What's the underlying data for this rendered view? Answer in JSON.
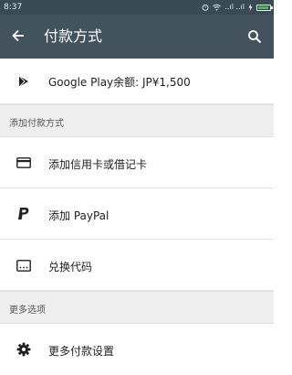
{
  "status_bar": {
    "time": "8:37",
    "signal_text": "..ıl ..ıl"
  },
  "app_bar": {
    "title": "付款方式",
    "back_icon": "arrow-left-icon",
    "search_icon": "search-icon"
  },
  "balance": {
    "icon": "google-play-icon",
    "label": "Google Play余额: JP¥1,500"
  },
  "add_section": {
    "header": "添加付款方式",
    "items": [
      {
        "icon": "credit-card-icon",
        "label": "添加信用卡或借记卡"
      },
      {
        "icon": "paypal-icon",
        "label": "添加 PayPal"
      },
      {
        "icon": "redeem-code-icon",
        "label": "兑换代码"
      }
    ]
  },
  "more_section": {
    "header": "更多选项",
    "items": [
      {
        "icon": "gear-icon",
        "label": "更多付款设置"
      }
    ]
  },
  "colors": {
    "status_bar": "#3a4a55",
    "app_bar": "#43535e",
    "section_bg": "#efefef",
    "battery": "#38c34a"
  }
}
